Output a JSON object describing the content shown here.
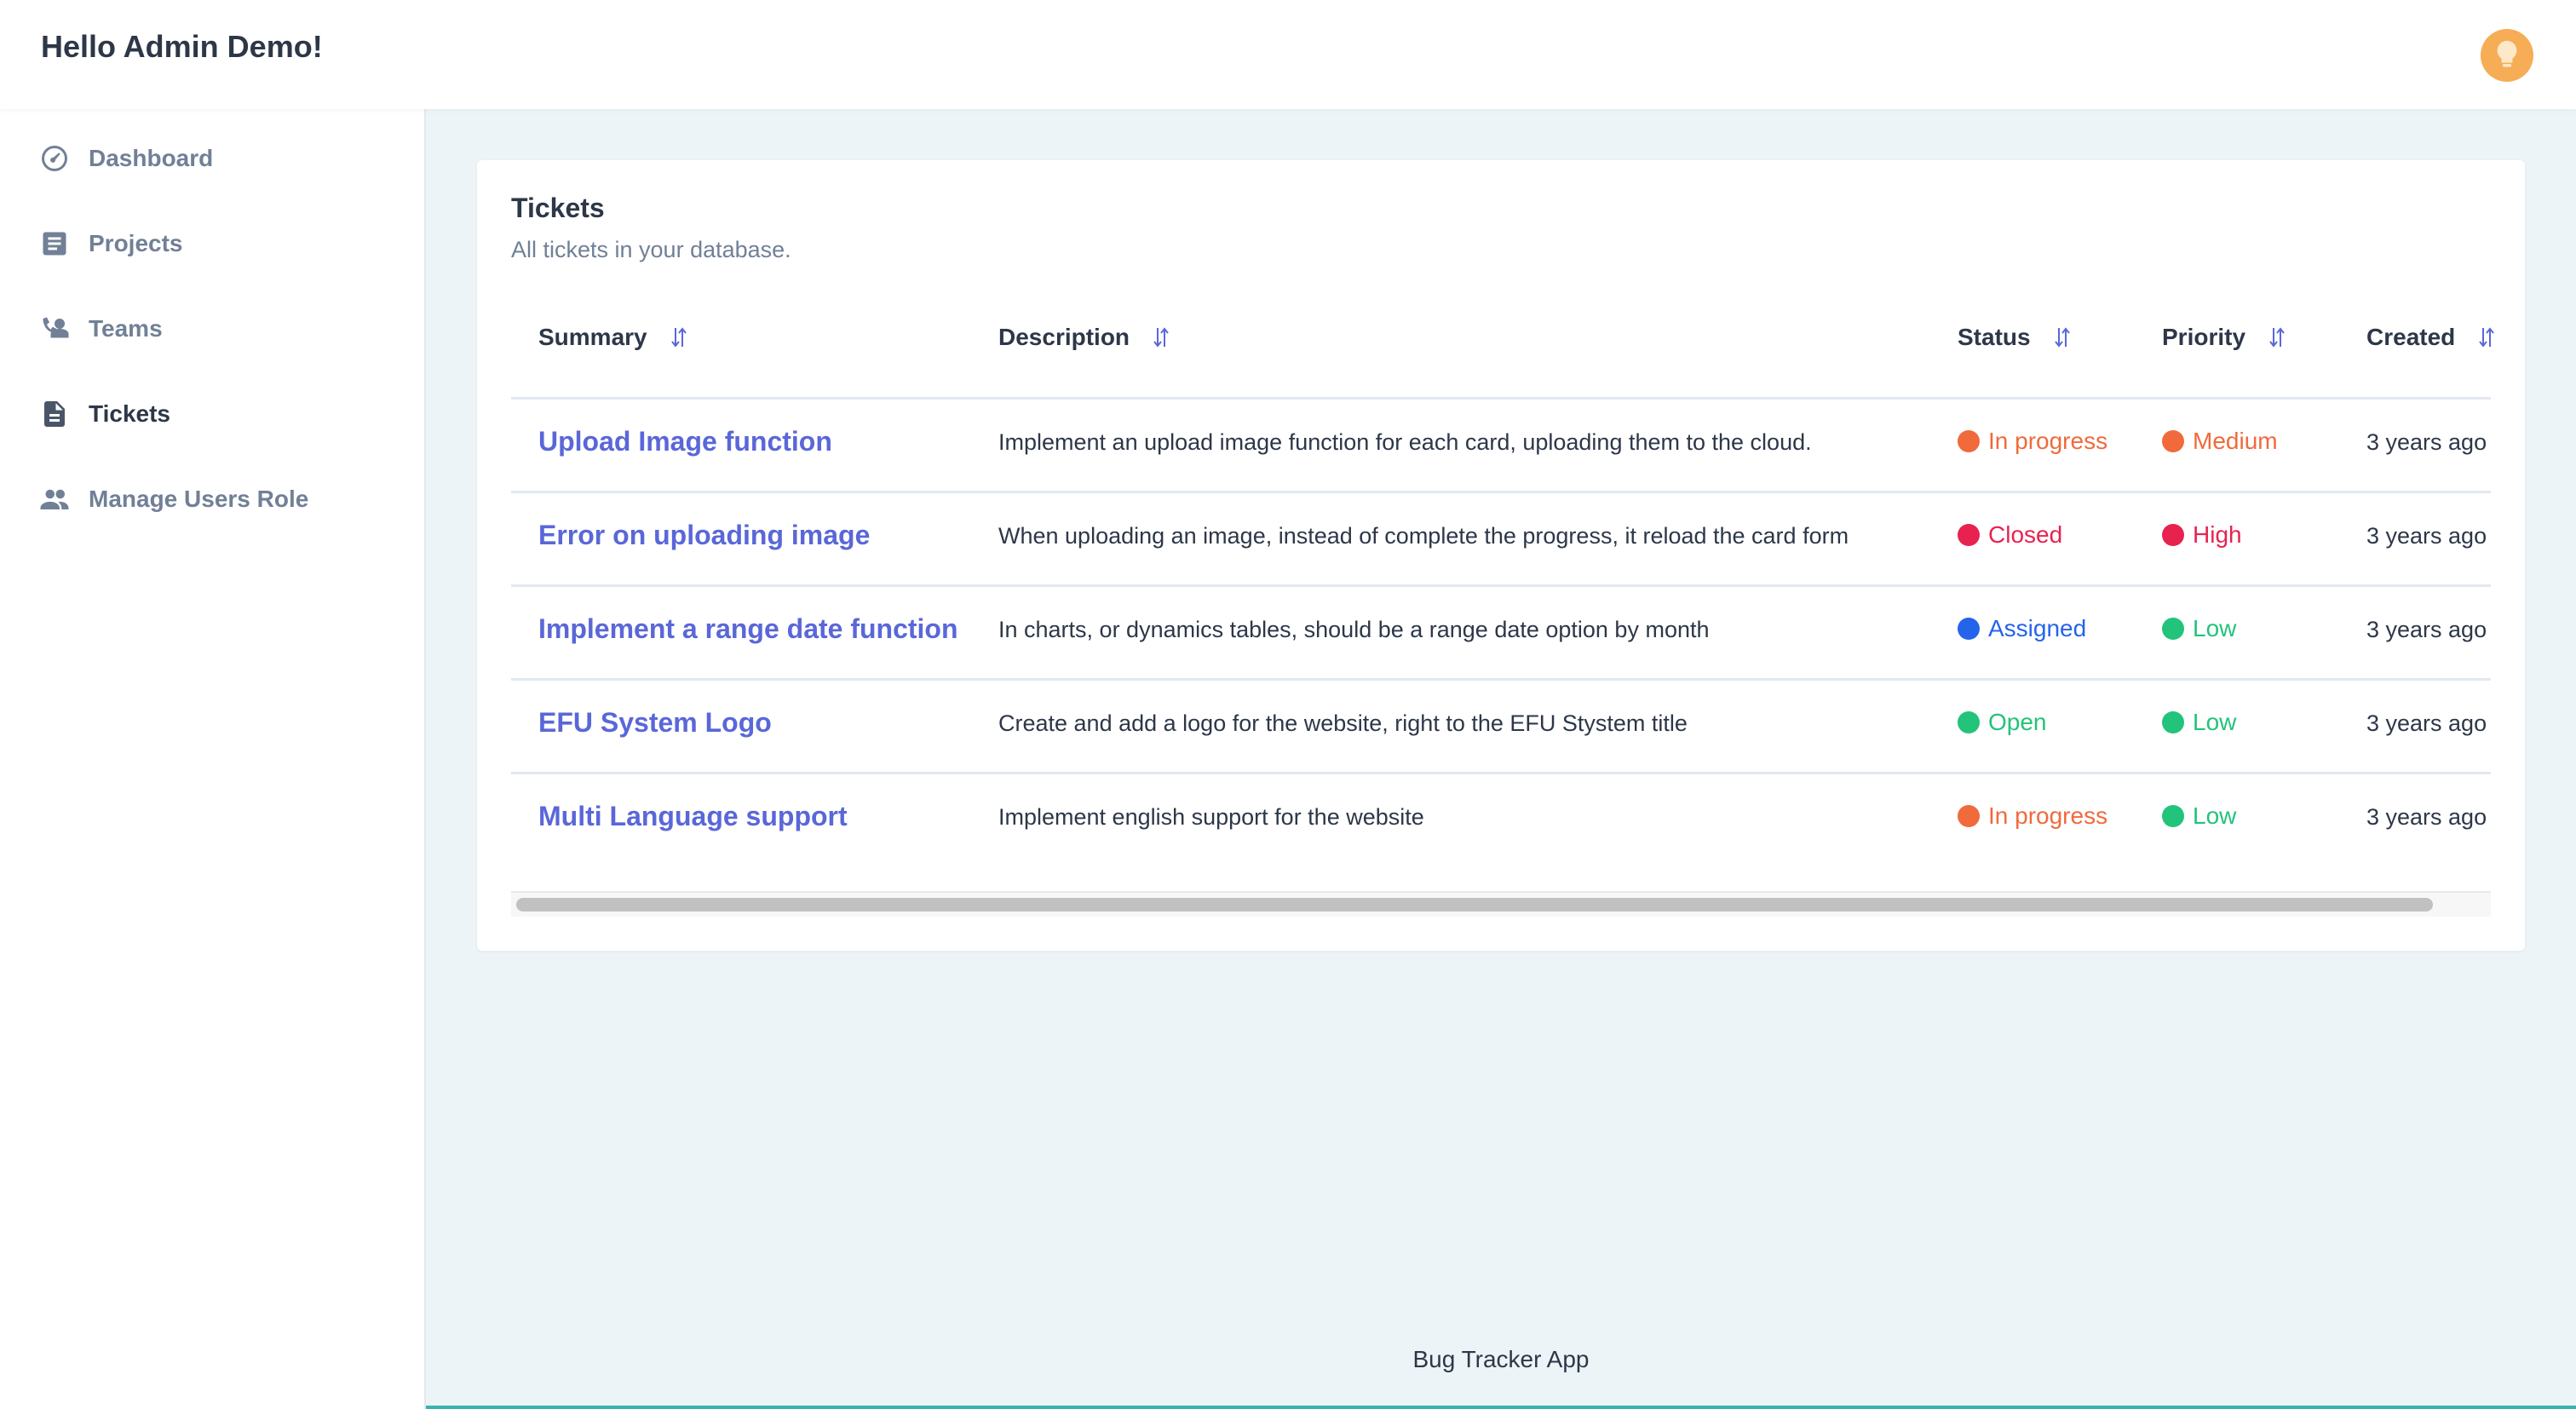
{
  "header": {
    "greeting": "Hello Admin Demo!"
  },
  "sidebar": {
    "items": [
      {
        "label": "Dashboard",
        "icon": "speedometer-icon"
      },
      {
        "label": "Projects",
        "icon": "document-list-icon"
      },
      {
        "label": "Teams",
        "icon": "phone-person-icon"
      },
      {
        "label": "Tickets",
        "icon": "file-icon",
        "active": true
      },
      {
        "label": "Manage Users Role",
        "icon": "users-icon"
      }
    ]
  },
  "card": {
    "title": "Tickets",
    "subtitle": "All tickets in your database."
  },
  "table": {
    "columns": [
      "Summary",
      "Description",
      "Status",
      "Priority",
      "Created"
    ],
    "rows": [
      {
        "summary": "Upload Image function",
        "description": "Implement an upload image function for each card, uploading them to the cloud.",
        "status": "In progress",
        "priority": "Medium",
        "created": "3 years ago"
      },
      {
        "summary": "Error on uploading image",
        "description": "When uploading an image, instead of complete the progress, it reload the card form",
        "status": "Closed",
        "priority": "High",
        "created": "3 years ago"
      },
      {
        "summary": "Implement a range date function",
        "description": "In charts, or dynamics tables, should be a range date option by month",
        "status": "Assigned",
        "priority": "Low",
        "created": "3 years ago"
      },
      {
        "summary": "EFU System Logo",
        "description": "Create and add a logo for the website, right to the EFU Stystem title",
        "status": "Open",
        "priority": "Low",
        "created": "3 years ago"
      },
      {
        "summary": "Multi Language support",
        "description": "Implement english support for the website",
        "status": "In progress",
        "priority": "Low",
        "created": "3 years ago"
      }
    ]
  },
  "colors": {
    "in_progress": "#f06a3c",
    "medium": "#f06a3c",
    "closed": "#e8224f",
    "high": "#e8224f",
    "assigned": "#2563eb",
    "open": "#22c37a",
    "low": "#22c37a",
    "link": "#5a67d8",
    "accent": "#38b2ac"
  },
  "footer": {
    "text": "Bug Tracker App"
  }
}
